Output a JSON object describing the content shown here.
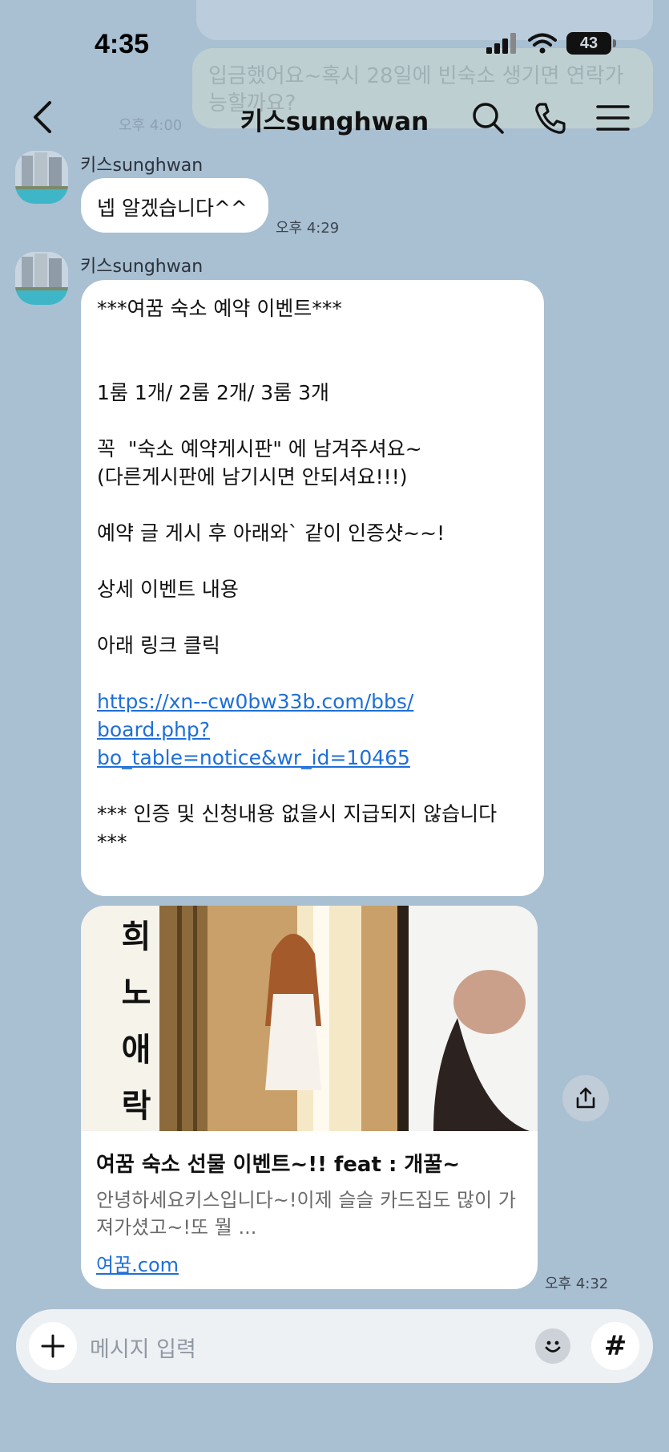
{
  "status": {
    "time": "4:35",
    "battery": "43"
  },
  "background_ghost": {
    "text": "입금했어요~혹시 28일에 빈숙소 생기면 연락가능할까요?",
    "time": "오후 4:00"
  },
  "header": {
    "title": "키스sunghwan"
  },
  "messages": [
    {
      "sender": "키스sunghwan",
      "text": "넵 알겠습니다^^",
      "time": "오후 4:29"
    },
    {
      "sender": "키스sunghwan",
      "lines": [
        "***여꿈 숙소 예약 이벤트***",
        "",
        "",
        "1룸 1개/ 2룸 2개/ 3룸 3개",
        "",
        "꼭  \"숙소 예약게시판\" 에 남겨주셔요~",
        "(다른게시판에 남기시면 안되셔요!!!)",
        "",
        "예약 글 게시 후 아래와` 같이 인증샷~~!",
        "",
        "상세 이벤트 내용",
        "",
        "아래 링크 클릭",
        ""
      ],
      "link_lines": [
        "https://xn--cw0bw33b.com/bbs/",
        "board.php?",
        "bo_table=notice&wr_id=10465"
      ],
      "footer_lines": [
        "",
        "*** 인증 및 신청내용 없을시 지급되지 않습니다",
        "***"
      ]
    }
  ],
  "link_card": {
    "image_text": [
      "희",
      "노",
      "애",
      "락"
    ],
    "title": "여꿈 숙소 선물 이벤트~!! feat : 개꿀~",
    "description": "안녕하세요키스입니다~!이제 슬슬 카드집도 많이 가져가셨고~!또 뭘 ...",
    "domain": "여꿈.com",
    "time": "오후 4:32"
  },
  "input": {
    "placeholder": "메시지 입력"
  },
  "colors": {
    "background": "#a9bfd2",
    "link": "#1f6fd8",
    "bubble": "#ffffff"
  }
}
